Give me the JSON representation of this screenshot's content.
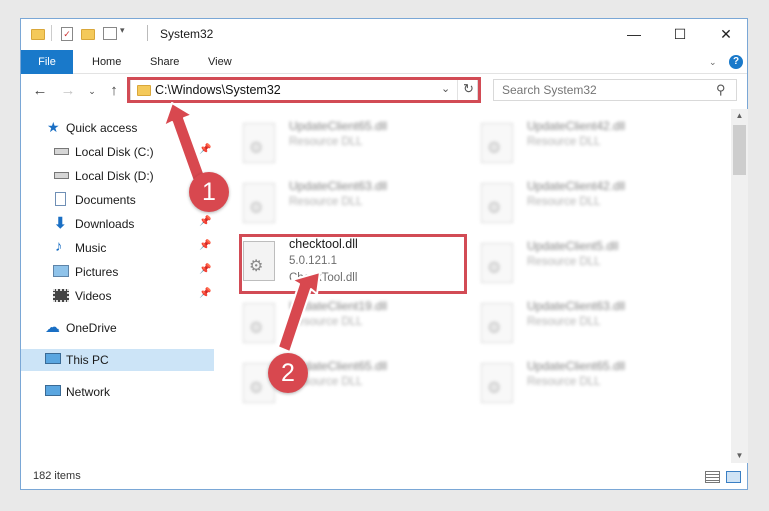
{
  "window": {
    "title": "System32",
    "controls": {
      "minimize": "—",
      "maximize": "☐",
      "close": "✕"
    }
  },
  "ribbon": {
    "tabs": [
      "File",
      "Home",
      "Share",
      "View"
    ],
    "help": "?"
  },
  "navigation": {
    "address": "C:\\Windows\\System32",
    "search_placeholder": "Search System32"
  },
  "sidebar": {
    "items": [
      {
        "label": "Quick access",
        "icon": "star-icon",
        "pinned": false
      },
      {
        "label": "Local Disk (C:)",
        "icon": "drive-icon",
        "pinned": true
      },
      {
        "label": "Local Disk (D:)",
        "icon": "drive-icon",
        "pinned": false
      },
      {
        "label": "Documents",
        "icon": "documents-icon",
        "pinned": true
      },
      {
        "label": "Downloads",
        "icon": "download-icon",
        "pinned": true
      },
      {
        "label": "Music",
        "icon": "music-icon",
        "pinned": true
      },
      {
        "label": "Pictures",
        "icon": "pictures-icon",
        "pinned": true
      },
      {
        "label": "Videos",
        "icon": "videos-icon",
        "pinned": true
      },
      {
        "label": "OneDrive",
        "icon": "cloud-icon",
        "pinned": false
      },
      {
        "label": "This PC",
        "icon": "computer-icon",
        "pinned": false,
        "selected": true
      },
      {
        "label": "Network",
        "icon": "network-icon",
        "pinned": false
      }
    ]
  },
  "files": [
    {
      "name": "UpdateClient65.dll",
      "type": "Resource DLL"
    },
    {
      "name": "UpdateClient42.dll",
      "type": "Resource DLL"
    },
    {
      "name": "UpdateClient63.dll",
      "type": "Resource DLL"
    },
    {
      "name": "UpdateClient42.dll",
      "type": "Resource DLL"
    },
    {
      "name": "checktool.dll",
      "version": "5.0.121.1",
      "description": "CheckTool.dll",
      "highlighted": true
    },
    {
      "name": "UpdateClient5.dll",
      "type": "Resource DLL"
    },
    {
      "name": "UpdateClient19.dll",
      "type": "Resource DLL"
    },
    {
      "name": "UpdateClient63.dll",
      "type": "Resource DLL"
    },
    {
      "name": "UpdateClient65.dll",
      "type": "Resource DLL"
    },
    {
      "name": "UpdateClient65.dll",
      "type": "Resource DLL"
    }
  ],
  "status": {
    "item_count": "182 items"
  },
  "annotations": {
    "marker_1": "1",
    "marker_2": "2",
    "color": "#d24b55"
  }
}
